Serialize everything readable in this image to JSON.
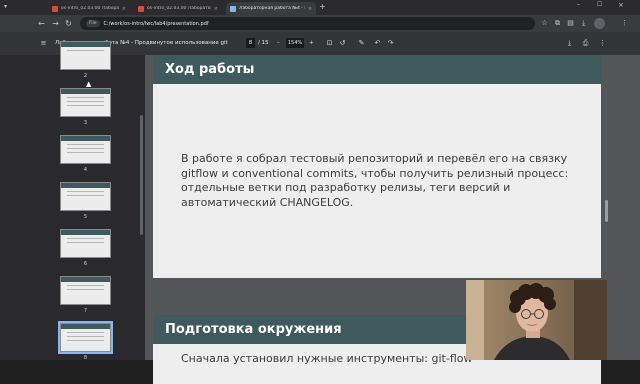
{
  "tabs": [
    {
      "label": "os-intro_02.03.00 Лабораторная р",
      "active": false
    },
    {
      "label": "os-intro_02.03.00 Лабораторная р",
      "active": false
    },
    {
      "label": "Лабораторная работа №4 - П",
      "active": true
    }
  ],
  "address": {
    "chip": "File",
    "url": "C:/work/os-intro/lwc/lab4/presentation.pdf"
  },
  "pdf_toolbar": {
    "title": "Лабораторная работа №4 - Продвинутое использование git",
    "page_current": "8",
    "page_total": "/ 15",
    "zoom": "154%",
    "zoom_out": "–",
    "zoom_in": "+"
  },
  "thumbnails": [
    {
      "label": "2"
    },
    {
      "label": "3"
    },
    {
      "label": "4"
    },
    {
      "label": "5"
    },
    {
      "label": "6"
    },
    {
      "label": "7"
    },
    {
      "label": "8"
    }
  ],
  "slides": [
    {
      "heading": "Ход работы",
      "body": "В работе я собрал тестовый репозиторий и перевёл его на связку gitflow и conventional commits, чтобы получить релизный процесс: отдельные ветки под разработку релизы, теги версий и автоматический CHANGELOG."
    },
    {
      "heading": "Подготовка окружения",
      "body": "Сначала установил нужные инструменты: git-flow"
    }
  ],
  "colors": {
    "slide_header": "#3f5a5c",
    "viewer_bg": "#525659",
    "toolbar_bg": "#323639"
  },
  "icons": {
    "menu": "hamburger-icon",
    "back": "arrow-left-icon",
    "forward": "arrow-right-icon",
    "reload": "reload-icon"
  }
}
